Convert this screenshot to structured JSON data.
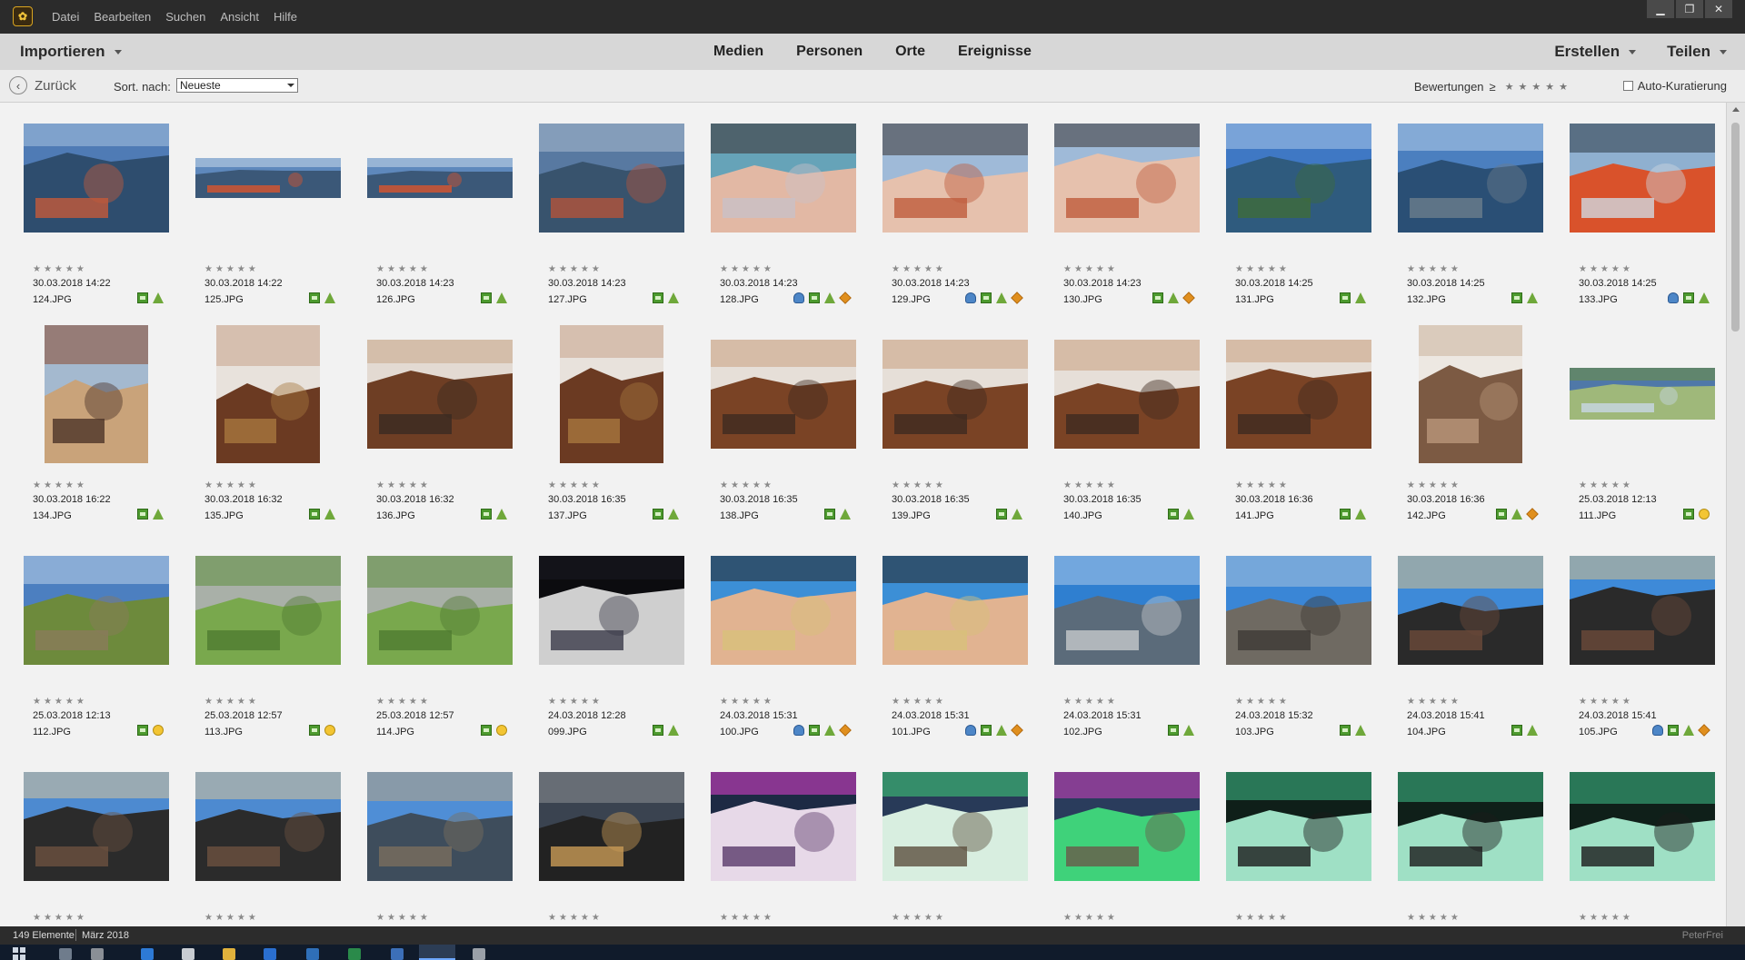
{
  "window": {
    "menu": [
      "Datei",
      "Bearbeiten",
      "Suchen",
      "Ansicht",
      "Hilfe"
    ],
    "controls": {
      "minimize": "▁",
      "maximize": "❐",
      "close": "✕"
    }
  },
  "toolbar": {
    "import_label": "Importieren",
    "tabs": [
      "Medien",
      "Personen",
      "Orte",
      "Ereignisse"
    ],
    "create_label": "Erstellen",
    "share_label": "Teilen"
  },
  "subbar": {
    "back_label": "Zurück",
    "sort_label": "Sort. nach:",
    "sort_value": "Neueste",
    "ratings_label": "Bewertungen",
    "ratings_ge": "≥",
    "ratings_stars": "★★★★★",
    "auto_curation_label": "Auto-Kuratierung"
  },
  "colors": {
    "accent": "#f2c43a",
    "album_icon": "#4d9a2f",
    "person_icon": "#4d86c7",
    "event_icon": "#e08f1e",
    "place_icon": "#6fa83a"
  },
  "media": [
    {
      "date": "30.03.2018 14:22",
      "file": "124.JPG",
      "shape": "land",
      "icons": [
        "album",
        "place"
      ],
      "palette": [
        "#4f7bb5",
        "#a8c2de",
        "#2e4d6e",
        "#c45a3a"
      ]
    },
    {
      "date": "30.03.2018 14:22",
      "file": "125.JPG",
      "shape": "pano",
      "icons": [
        "album",
        "place"
      ],
      "palette": [
        "#5e88bc",
        "#c7d8ea",
        "#3b5878",
        "#d9552d"
      ]
    },
    {
      "date": "30.03.2018 14:23",
      "file": "126.JPG",
      "shape": "pano",
      "icons": [
        "album",
        "place"
      ],
      "palette": [
        "#5e88bc",
        "#c7d8ea",
        "#3b5878",
        "#d9552d"
      ]
    },
    {
      "date": "30.03.2018 14:23",
      "file": "127.JPG",
      "shape": "land",
      "icons": [
        "album",
        "place"
      ],
      "palette": [
        "#5879a1",
        "#aabbd0",
        "#38536d",
        "#b3543a"
      ]
    },
    {
      "date": "30.03.2018 14:23",
      "file": "128.JPG",
      "shape": "land",
      "icons": [
        "person",
        "album",
        "place",
        "event"
      ],
      "palette": [
        "#66a3b8",
        "#3a3030",
        "#e2b8a4",
        "#c9c1c7"
      ]
    },
    {
      "date": "30.03.2018 14:23",
      "file": "129.JPG",
      "shape": "land",
      "icons": [
        "person",
        "album",
        "place",
        "event"
      ],
      "palette": [
        "#9fbad8",
        "#3a3535",
        "#e6c1ad",
        "#bf5b3b"
      ]
    },
    {
      "date": "30.03.2018 14:23",
      "file": "130.JPG",
      "shape": "land",
      "icons": [
        "album",
        "place",
        "event"
      ],
      "palette": [
        "#9fbad8",
        "#3a3535",
        "#e6c1ad",
        "#bf5b3b"
      ]
    },
    {
      "date": "30.03.2018 14:25",
      "file": "131.JPG",
      "shape": "land",
      "icons": [
        "album",
        "place"
      ],
      "palette": [
        "#3f78c4",
        "#a9c7ea",
        "#2f5b7e",
        "#3f6b3a"
      ]
    },
    {
      "date": "30.03.2018 14:25",
      "file": "132.JPG",
      "shape": "land",
      "icons": [
        "album",
        "place"
      ],
      "palette": [
        "#4b7fbf",
        "#b5cde9",
        "#2a4f75",
        "#6b7d8c"
      ]
    },
    {
      "date": "30.03.2018 14:25",
      "file": "133.JPG",
      "shape": "land",
      "icons": [
        "person",
        "album",
        "place"
      ],
      "palette": [
        "#8fb0d0",
        "#2e3a45",
        "#d9522b",
        "#cfd8e0"
      ]
    },
    {
      "date": "30.03.2018 16:22",
      "file": "134.JPG",
      "shape": "port",
      "icons": [
        "album",
        "place"
      ],
      "palette": [
        "#a4b9cf",
        "#8a4a30",
        "#c9a37a",
        "#4c3328"
      ]
    },
    {
      "date": "30.03.2018 16:32",
      "file": "135.JPG",
      "shape": "port",
      "icons": [
        "album",
        "place"
      ],
      "palette": [
        "#e8e2dc",
        "#c7a28a",
        "#6b3a22",
        "#a7773f"
      ]
    },
    {
      "date": "30.03.2018 16:32",
      "file": "136.JPG",
      "shape": "land",
      "icons": [
        "album",
        "place"
      ],
      "palette": [
        "#e3dad2",
        "#c8a888",
        "#6e3e24",
        "#3a2a22"
      ]
    },
    {
      "date": "30.03.2018 16:35",
      "file": "137.JPG",
      "shape": "port",
      "icons": [
        "album",
        "place"
      ],
      "palette": [
        "#e8e2dc",
        "#c7a28a",
        "#6b3a22",
        "#a7773f"
      ]
    },
    {
      "date": "30.03.2018 16:35",
      "file": "138.JPG",
      "shape": "land",
      "icons": [
        "album",
        "place"
      ],
      "palette": [
        "#e6dfd8",
        "#c89f7f",
        "#7a4325",
        "#3e2b20"
      ]
    },
    {
      "date": "30.03.2018 16:35",
      "file": "139.JPG",
      "shape": "land",
      "icons": [
        "album",
        "place"
      ],
      "palette": [
        "#e6dfd8",
        "#c89f7f",
        "#7a4325",
        "#3e2b20"
      ]
    },
    {
      "date": "30.03.2018 16:35",
      "file": "140.JPG",
      "shape": "land",
      "icons": [
        "album",
        "place"
      ],
      "palette": [
        "#e6dfd8",
        "#c89f7f",
        "#7a4325",
        "#3e2b20"
      ]
    },
    {
      "date": "30.03.2018 16:36",
      "file": "141.JPG",
      "shape": "land",
      "icons": [
        "album",
        "place"
      ],
      "palette": [
        "#e6dfd8",
        "#c89f7f",
        "#7a4325",
        "#3e2b20"
      ]
    },
    {
      "date": "30.03.2018 16:36",
      "file": "142.JPG",
      "shape": "port",
      "icons": [
        "album",
        "place",
        "event"
      ],
      "palette": [
        "#ede8e2",
        "#cbb39c",
        "#7c5a43",
        "#b9967a"
      ]
    },
    {
      "date": "25.03.2018 12:13",
      "file": "111.JPG",
      "shape": "pano2",
      "icons": [
        "album",
        "smart"
      ],
      "palette": [
        "#4f78a8",
        "#6f8f3c",
        "#9fb87a",
        "#c8d7e6"
      ]
    },
    {
      "date": "25.03.2018 12:13",
      "file": "112.JPG",
      "shape": "land",
      "icons": [
        "album",
        "smart"
      ],
      "palette": [
        "#4c7fc0",
        "#bcd1e7",
        "#6d8a3c",
        "#8a7a5a"
      ]
    },
    {
      "date": "25.03.2018 12:57",
      "file": "113.JPG",
      "shape": "land",
      "icons": [
        "album",
        "smart"
      ],
      "palette": [
        "#a9b0a8",
        "#5f8f3e",
        "#79a84d",
        "#4f7a31"
      ]
    },
    {
      "date": "25.03.2018 12:57",
      "file": "114.JPG",
      "shape": "land",
      "icons": [
        "album",
        "smart"
      ],
      "palette": [
        "#a9b0a8",
        "#5f8f3e",
        "#79a84d",
        "#4f7a31"
      ]
    },
    {
      "date": "24.03.2018 12:28",
      "file": "099.JPG",
      "shape": "land",
      "icons": [
        "album",
        "place"
      ],
      "palette": [
        "#0c0c0f",
        "#1a1a22",
        "#cfcfcf",
        "#3a3a48"
      ]
    },
    {
      "date": "24.03.2018 15:31",
      "file": "100.JPG",
      "shape": "land",
      "icons": [
        "person",
        "album",
        "place",
        "event"
      ],
      "palette": [
        "#3c8fd6",
        "#252525",
        "#e1b391",
        "#d8c07a"
      ]
    },
    {
      "date": "24.03.2018 15:31",
      "file": "101.JPG",
      "shape": "land",
      "icons": [
        "person",
        "album",
        "place",
        "event"
      ],
      "palette": [
        "#3c8fd6",
        "#252525",
        "#e1b391",
        "#d8c07a"
      ]
    },
    {
      "date": "24.03.2018 15:31",
      "file": "102.JPG",
      "shape": "land",
      "icons": [
        "album",
        "place"
      ],
      "palette": [
        "#2f7fd0",
        "#a9c9ea",
        "#5b6b7a",
        "#c6c9cc"
      ]
    },
    {
      "date": "24.03.2018 15:32",
      "file": "103.JPG",
      "shape": "land",
      "icons": [
        "album",
        "place"
      ],
      "palette": [
        "#3a86d6",
        "#a6c3df",
        "#6f6a62",
        "#3d3a36"
      ]
    },
    {
      "date": "24.03.2018 15:41",
      "file": "104.JPG",
      "shape": "land",
      "icons": [
        "album",
        "place"
      ],
      "palette": [
        "#3e8ad8",
        "#d6c08d",
        "#2a2a2a",
        "#6b4a3a"
      ]
    },
    {
      "date": "24.03.2018 15:41",
      "file": "105.JPG",
      "shape": "land",
      "icons": [
        "person",
        "album",
        "place",
        "event"
      ],
      "palette": [
        "#3e8ad8",
        "#d6c08d",
        "#2a2a2a",
        "#6b4a3a"
      ]
    },
    {
      "date": "",
      "file": "",
      "shape": "land",
      "icons": [],
      "palette": [
        "#4d8ad0",
        "#d9c49a",
        "#2b2b2b",
        "#6d5140"
      ]
    },
    {
      "date": "",
      "file": "",
      "shape": "land",
      "icons": [],
      "palette": [
        "#4d8ad0",
        "#d9c49a",
        "#2b2b2b",
        "#6d5140"
      ]
    },
    {
      "date": "",
      "file": "",
      "shape": "land",
      "icons": [],
      "palette": [
        "#4f8ed6",
        "#b8a485",
        "#3e4d5c",
        "#7b6e5e"
      ]
    },
    {
      "date": "",
      "file": "",
      "shape": "land",
      "icons": [],
      "palette": [
        "#3a4350",
        "#8c8f93",
        "#222",
        "#c99b56"
      ]
    },
    {
      "date": "",
      "file": "",
      "shape": "land",
      "icons": [],
      "palette": [
        "#1d2a44",
        "#e03fd0",
        "#e7d9e8",
        "#5a3a6a"
      ]
    },
    {
      "date": "",
      "file": "",
      "shape": "land",
      "icons": [],
      "palette": [
        "#283a58",
        "#3fd27a",
        "#d8eee0",
        "#5d4f3e"
      ]
    },
    {
      "date": "",
      "file": "",
      "shape": "land",
      "icons": [],
      "palette": [
        "#2a3c5c",
        "#d03fc0",
        "#3fd27a",
        "#6a5a4a"
      ]
    },
    {
      "date": "",
      "file": "",
      "shape": "land",
      "icons": [],
      "palette": [
        "#0f1f19",
        "#3fbf8a",
        "#9fe0c5",
        "#1b1b1b"
      ]
    },
    {
      "date": "",
      "file": "",
      "shape": "land",
      "icons": [],
      "palette": [
        "#0f1f19",
        "#3fbf8a",
        "#9fe0c5",
        "#1b1b1b"
      ]
    },
    {
      "date": "",
      "file": "",
      "shape": "land",
      "icons": [],
      "palette": [
        "#0f1f19",
        "#3fbf8a",
        "#9fe0c5",
        "#1b1b1b"
      ]
    }
  ],
  "status": {
    "count": "149 Elemente",
    "period": "März 2018",
    "user": "PeterFrei"
  }
}
